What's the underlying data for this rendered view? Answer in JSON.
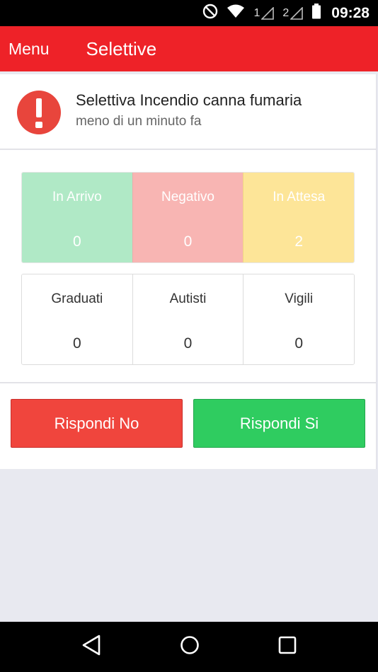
{
  "status_bar": {
    "sim1": "1",
    "sim2": "2",
    "time": "09:28"
  },
  "app_bar": {
    "menu_label": "Menu",
    "title": "Selettive"
  },
  "alert": {
    "title": "Selettiva Incendio canna fumaria",
    "time": "meno di un minuto fa",
    "icon": "exclamation-icon"
  },
  "status_counts": [
    {
      "label": "In Arrivo",
      "value": "0",
      "color": "#b0e9c6"
    },
    {
      "label": "Negativo",
      "value": "0",
      "color": "#f8b5b3"
    },
    {
      "label": "In Attesa",
      "value": "2",
      "color": "#fde598"
    }
  ],
  "role_counts": [
    {
      "label": "Graduati",
      "value": "0"
    },
    {
      "label": "Autisti",
      "value": "0"
    },
    {
      "label": "Vigili",
      "value": "0"
    }
  ],
  "actions": {
    "no_label": "Rispondi No",
    "si_label": "Rispondi Si",
    "no_color": "#f0453d",
    "si_color": "#2fcc60"
  },
  "colors": {
    "app_bar": "#ee2228",
    "alert_icon": "#e8453c"
  },
  "nav_bar": {
    "back_icon": "back-icon",
    "home_icon": "home-icon",
    "recents_icon": "recents-icon"
  }
}
